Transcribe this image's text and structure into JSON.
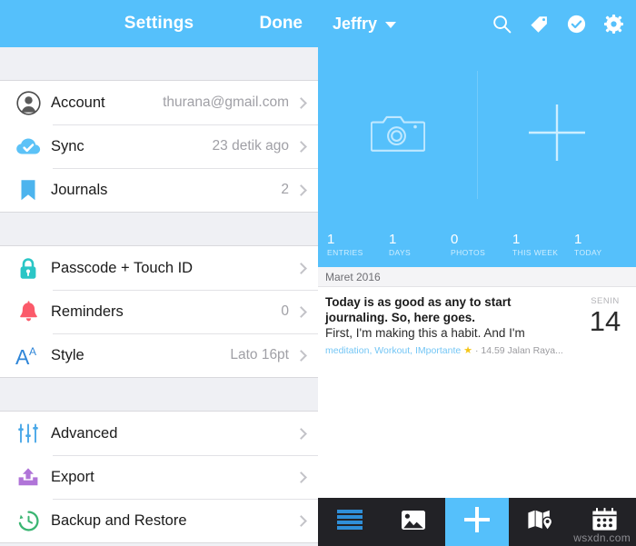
{
  "settings": {
    "title": "Settings",
    "done_label": "Done",
    "groups": [
      {
        "rows": [
          {
            "icon": "account-icon",
            "label": "Account",
            "value": "thurana@gmail.com"
          },
          {
            "icon": "sync-cloud-icon",
            "label": "Sync",
            "value": "23 detik ago"
          },
          {
            "icon": "bookmark-icon",
            "label": "Journals",
            "value": "2"
          }
        ]
      },
      {
        "rows": [
          {
            "icon": "lock-icon",
            "label": "Passcode + Touch ID",
            "value": ""
          },
          {
            "icon": "bell-icon",
            "label": "Reminders",
            "value": "0"
          },
          {
            "icon": "font-style-icon",
            "label": "Style",
            "value": "Lato 16pt"
          }
        ]
      },
      {
        "rows": [
          {
            "icon": "sliders-icon",
            "label": "Advanced",
            "value": ""
          },
          {
            "icon": "export-upload-icon",
            "label": "Export",
            "value": ""
          },
          {
            "icon": "backup-restore-icon",
            "label": "Backup and Restore",
            "value": ""
          }
        ]
      }
    ]
  },
  "journal": {
    "header": {
      "user": "Jeffry",
      "icons": [
        "search-icon",
        "tag-icon",
        "check-circle-icon",
        "gear-icon"
      ]
    },
    "hero": {
      "camera_icon": "camera-icon",
      "plus_icon": "plus-icon"
    },
    "stats": [
      {
        "num": "1",
        "label": "ENTRIES"
      },
      {
        "num": "1",
        "label": "DAYS"
      },
      {
        "num": "0",
        "label": "PHOTOS"
      },
      {
        "num": "1",
        "label": "THIS WEEK"
      },
      {
        "num": "1",
        "label": "TODAY"
      }
    ],
    "month_label": "Maret 2016",
    "entry": {
      "line1": "Today is as good as any to start",
      "line2": "journaling. So, here goes.",
      "line3": "First, I'm making this a habit. And I'm",
      "tags": "meditation, Workout, IMportante",
      "star": "★",
      "meta": "· 14.59 Jalan Raya...",
      "day_of_week": "SENIN",
      "day_number": "14"
    },
    "tabs": [
      {
        "name": "list-tab",
        "icon": "list-icon",
        "active": false
      },
      {
        "name": "photos-tab",
        "icon": "photo-icon",
        "active": false
      },
      {
        "name": "new-entry-tab",
        "icon": "plus-icon",
        "active": true
      },
      {
        "name": "map-tab",
        "icon": "map-pin-icon",
        "active": false
      },
      {
        "name": "calendar-tab",
        "icon": "calendar-icon",
        "active": false
      }
    ]
  },
  "watermark": "wsxdn.com",
  "colors": {
    "brand_blue": "#55c0fb",
    "panel_grey": "#eff0f4",
    "tabbar_dark": "#222226",
    "tag_blue": "#74c6f5",
    "star_gold": "#f5c518"
  }
}
